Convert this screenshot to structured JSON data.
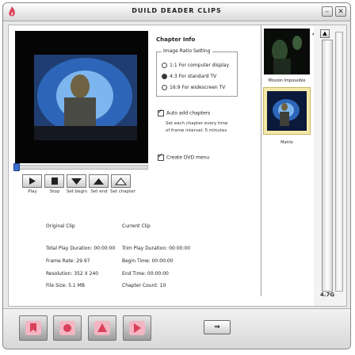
{
  "window": {
    "title": "DUILD DEADER CLIPS",
    "min_label": "–",
    "close_label": "✕"
  },
  "preview_controls": [
    {
      "name": "play-button",
      "label": "Play"
    },
    {
      "name": "stop-button",
      "label": "Stop"
    },
    {
      "name": "set-begin-button",
      "label": "Set begin"
    },
    {
      "name": "set-end-button",
      "label": "Set end"
    },
    {
      "name": "set-chapter-button",
      "label": "Set chapter"
    }
  ],
  "settings": {
    "heading": "Chapter Info",
    "group_title": "Image Ratio Setting",
    "ratios": [
      {
        "label": "1:1 For computer display",
        "checked": false
      },
      {
        "label": "4:3 For standard TV",
        "checked": true
      },
      {
        "label": "16:9 For widescreen TV",
        "checked": false
      }
    ],
    "auto_add": {
      "label": "Auto add chapters",
      "checked": true
    },
    "auto_add_sub": [
      "Set each chapter every time",
      "of frame interval: 5 minutes"
    ],
    "create_dvd_menu": {
      "label": "Create DVD menu",
      "checked": true
    }
  },
  "info": {
    "left": [
      "Original Clip",
      "Total Play Duration: 00:00:00",
      "Frame Rate: 29.97",
      "Resolution: 352 X 240",
      "File Size: 5.1 MB"
    ],
    "right": [
      "Current Clip",
      "Trim Play Duration: 00:00:00",
      "Begin Time: 00:00:00",
      "End Time: 00:00:00",
      "Chapter Count: 10"
    ]
  },
  "clips": [
    {
      "label": "Mission Impossible",
      "selected": false
    },
    {
      "label": "Matrix",
      "selected": true
    }
  ],
  "capacity": {
    "label": "4.7G",
    "up_label": "▲"
  },
  "toolbar": {
    "tools": [
      "open-tool",
      "remove-tool",
      "effects-tool",
      "settings-tool"
    ],
    "next_label": "⇒"
  },
  "footer": {
    "text": ""
  },
  "colors": {
    "accent": "#3a6fd4",
    "selected_clip": "#f5e9a8",
    "tool_red": "#d9405a"
  }
}
